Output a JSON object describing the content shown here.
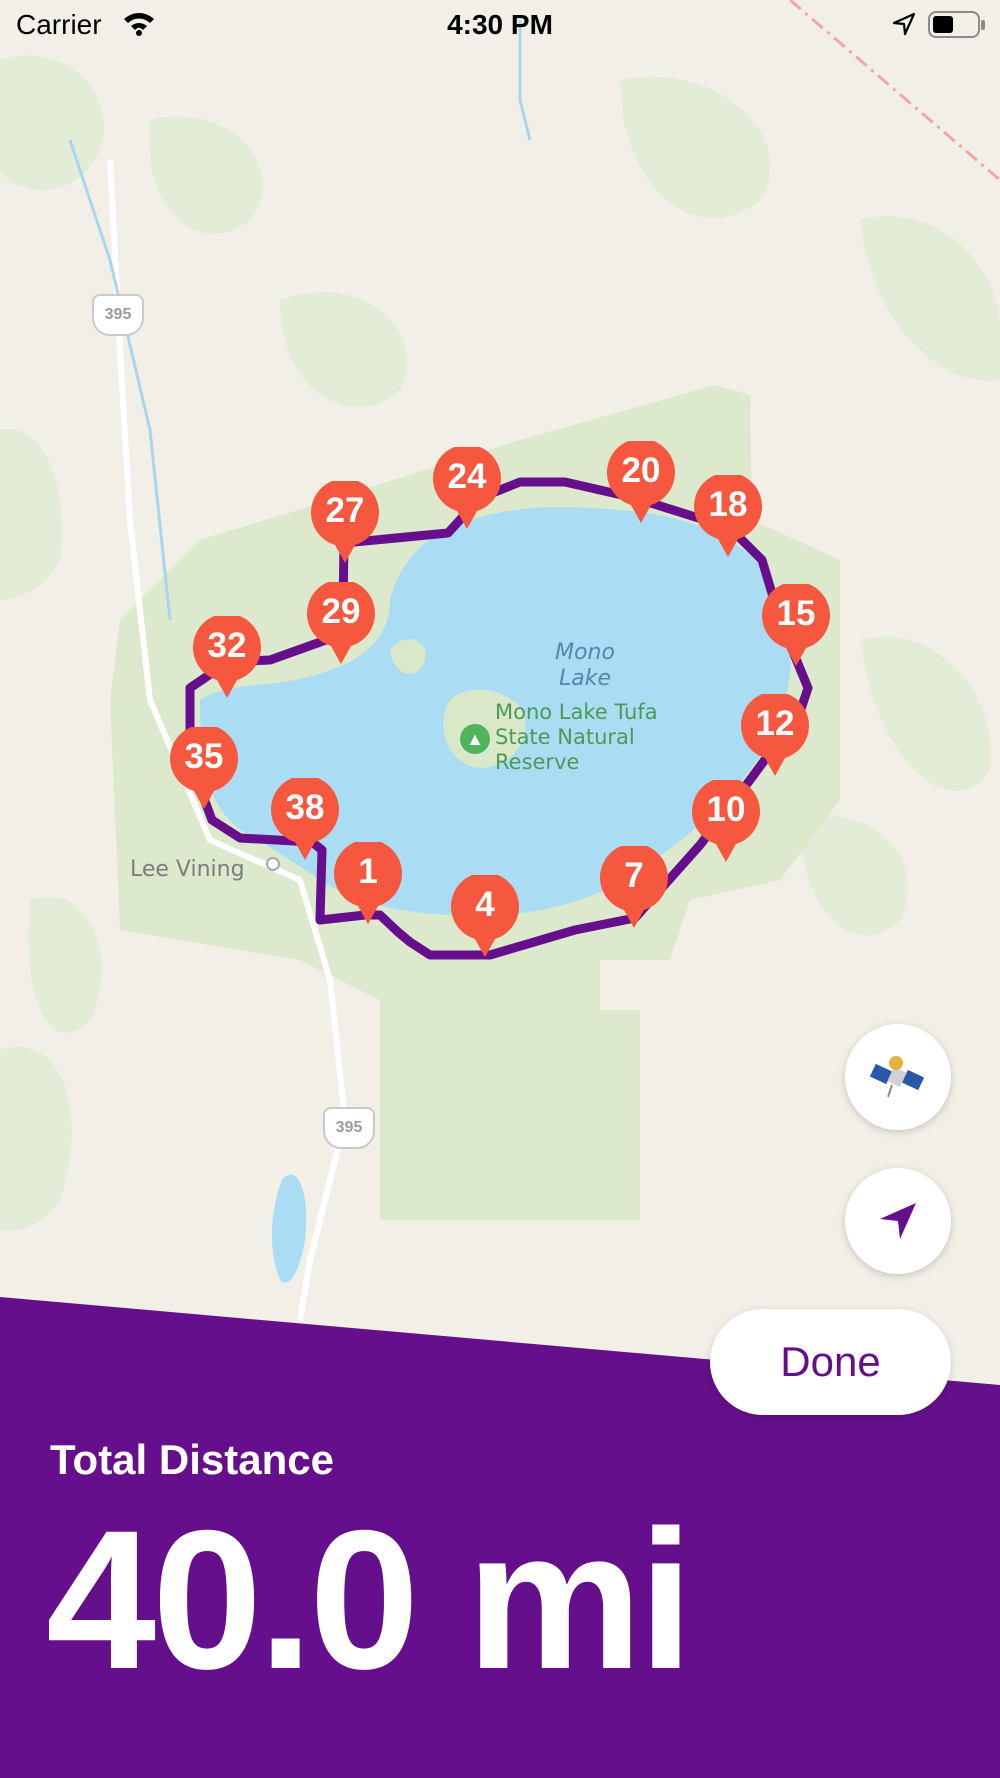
{
  "status_bar": {
    "carrier": "Carrier",
    "time": "4:30 PM"
  },
  "map": {
    "lake_name_line1": "Mono",
    "lake_name_line2": "Lake",
    "park_name_line1": "Mono Lake Tufa",
    "park_name_line2": "State Natural",
    "park_name_line3": "Reserve",
    "town_name": "Lee Vining",
    "highway_shield_1": "395",
    "highway_shield_2": "395",
    "route_color": "#660f8c",
    "pin_color": "#f5573f",
    "water_color": "#aadcf4",
    "park_color": "#d9e8c9",
    "waypoints": [
      "1",
      "4",
      "7",
      "10",
      "12",
      "15",
      "18",
      "20",
      "24",
      "27",
      "29",
      "32",
      "35",
      "38"
    ]
  },
  "controls": {
    "satellite_icon": "satellite-icon",
    "location_icon": "location-arrow-icon",
    "done_label": "Done"
  },
  "summary": {
    "label": "Total Distance",
    "value": "40.0 mi",
    "panel_color": "#660f8c"
  }
}
